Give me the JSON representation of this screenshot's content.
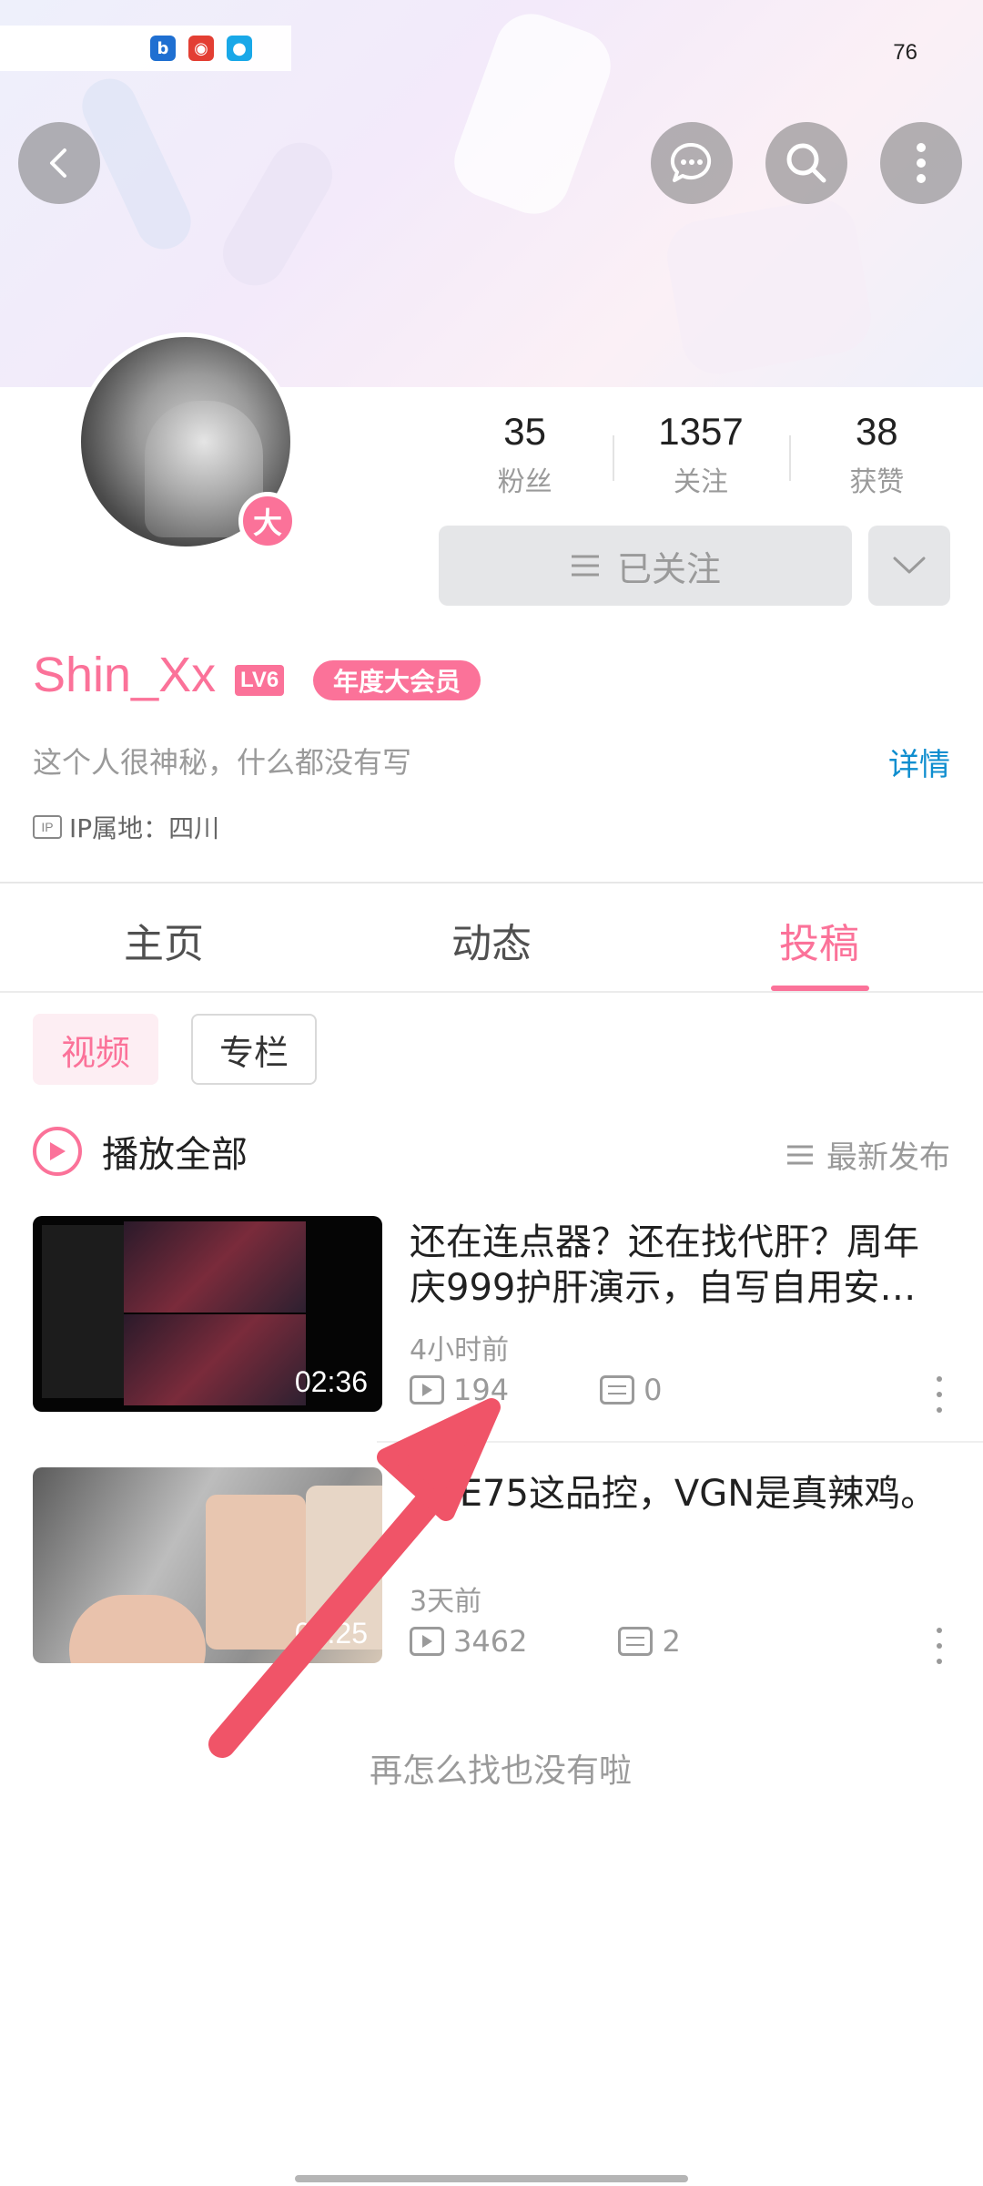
{
  "status_bar": {
    "battery": "76",
    "app_icons": [
      "b-icon",
      "weibo-icon",
      "qq-icon"
    ]
  },
  "header": {
    "back_icon": "chevron-left-icon",
    "actions": [
      "message-icon",
      "search-icon",
      "more-vertical-icon"
    ]
  },
  "profile": {
    "stats": [
      {
        "value": "35",
        "label": "粉丝"
      },
      {
        "value": "1357",
        "label": "关注"
      },
      {
        "value": "38",
        "label": "获赞"
      }
    ],
    "follow_label": "已关注",
    "username": "Shin_Xx",
    "level": "LV6",
    "vip_label": "年度大会员",
    "vip_badge": "大",
    "bio": "这个人很神秘，什么都没有写",
    "detail_label": "详情",
    "ip_icon_text": "IP",
    "ip_location": "IP属地：四川"
  },
  "tabs": [
    {
      "label": "主页",
      "active": false
    },
    {
      "label": "动态",
      "active": false
    },
    {
      "label": "投稿",
      "active": true
    }
  ],
  "filters": {
    "video": "视频",
    "column": "专栏"
  },
  "list_header": {
    "play_all": "播放全部",
    "sort_label": "最新发布"
  },
  "videos": [
    {
      "title": "还在连点器？还在找代肝？周年庆999护肝演示，自写自用安…",
      "time": "4小时前",
      "views": "194",
      "comments": "0",
      "duration": "02:36"
    },
    {
      "title": "VXE75这品控，VGN是真辣鸡。",
      "time": "3天前",
      "views": "3462",
      "comments": "2",
      "duration": "02:25"
    }
  ],
  "end_text": "再怎么找也没有啦",
  "colors": {
    "accent": "#fb7299",
    "link": "#0f8ecf",
    "annotation_arrow": "#f05468"
  }
}
